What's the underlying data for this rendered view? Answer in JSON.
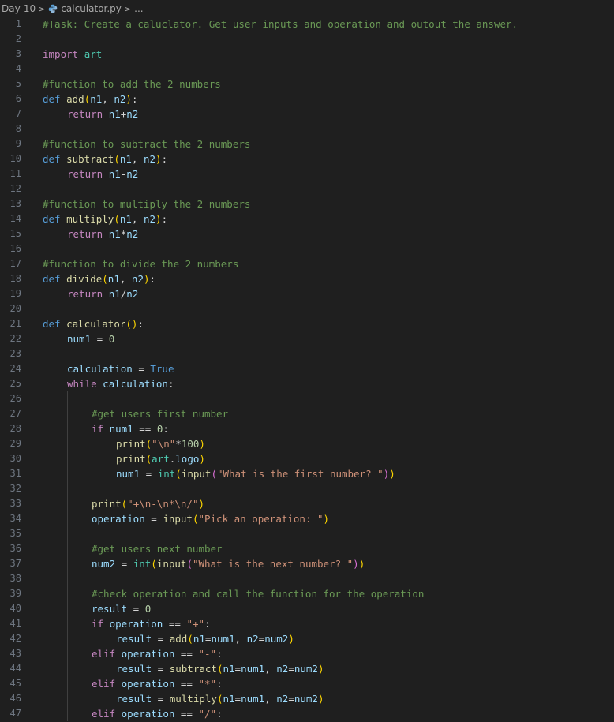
{
  "breadcrumb": {
    "folder": "Day-10",
    "file": "calculator.py",
    "more": "...",
    "separator": ">"
  },
  "colors": {
    "background": "#1f1f1f",
    "line_number": "#6e7681",
    "comment": "#6a9955",
    "keyword": "#569cd6",
    "control": "#c586c0",
    "function": "#dcdcaa",
    "string": "#ce9178",
    "number": "#b5cea8",
    "variable": "#9cdcfe",
    "bracket_1": "#ffd700",
    "bracket_2": "#da70d6",
    "bracket_3": "#179fff"
  },
  "icons": {
    "file_type": "python-file-icon"
  },
  "code": {
    "lines": [
      {
        "n": "1",
        "indent": 0,
        "tokens": [
          [
            "cm",
            "#Task: Create a caluclator. Get user inputs and operation and outout the answer."
          ]
        ]
      },
      {
        "n": "2",
        "indent": 0,
        "tokens": []
      },
      {
        "n": "3",
        "indent": 0,
        "tokens": [
          [
            "ctrl",
            "import"
          ],
          [
            "plain",
            " "
          ],
          [
            "type",
            "art"
          ]
        ]
      },
      {
        "n": "4",
        "indent": 0,
        "tokens": []
      },
      {
        "n": "5",
        "indent": 0,
        "tokens": [
          [
            "cm",
            "#function to add the 2 numbers"
          ]
        ]
      },
      {
        "n": "6",
        "indent": 0,
        "tokens": [
          [
            "kw",
            "def"
          ],
          [
            "plain",
            " "
          ],
          [
            "fn",
            "add"
          ],
          [
            "p1",
            "("
          ],
          [
            "var",
            "n1"
          ],
          [
            "plain",
            ", "
          ],
          [
            "var",
            "n2"
          ],
          [
            "p1",
            ")"
          ],
          [
            "plain",
            ":"
          ]
        ]
      },
      {
        "n": "7",
        "indent": 1,
        "tokens": [
          [
            "ctrl",
            "return"
          ],
          [
            "plain",
            " "
          ],
          [
            "var",
            "n1"
          ],
          [
            "plain",
            "+"
          ],
          [
            "var",
            "n2"
          ]
        ]
      },
      {
        "n": "8",
        "indent": 0,
        "tokens": []
      },
      {
        "n": "9",
        "indent": 0,
        "tokens": [
          [
            "cm",
            "#function to subtract the 2 numbers"
          ]
        ]
      },
      {
        "n": "10",
        "indent": 0,
        "tokens": [
          [
            "kw",
            "def"
          ],
          [
            "plain",
            " "
          ],
          [
            "fn",
            "subtract"
          ],
          [
            "p1",
            "("
          ],
          [
            "var",
            "n1"
          ],
          [
            "plain",
            ", "
          ],
          [
            "var",
            "n2"
          ],
          [
            "p1",
            ")"
          ],
          [
            "plain",
            ":"
          ]
        ]
      },
      {
        "n": "11",
        "indent": 1,
        "tokens": [
          [
            "ctrl",
            "return"
          ],
          [
            "plain",
            " "
          ],
          [
            "var",
            "n1"
          ],
          [
            "plain",
            "-"
          ],
          [
            "var",
            "n2"
          ]
        ]
      },
      {
        "n": "12",
        "indent": 0,
        "tokens": []
      },
      {
        "n": "13",
        "indent": 0,
        "tokens": [
          [
            "cm",
            "#function to multiply the 2 numbers"
          ]
        ]
      },
      {
        "n": "14",
        "indent": 0,
        "tokens": [
          [
            "kw",
            "def"
          ],
          [
            "plain",
            " "
          ],
          [
            "fn",
            "multiply"
          ],
          [
            "p1",
            "("
          ],
          [
            "var",
            "n1"
          ],
          [
            "plain",
            ", "
          ],
          [
            "var",
            "n2"
          ],
          [
            "p1",
            ")"
          ],
          [
            "plain",
            ":"
          ]
        ]
      },
      {
        "n": "15",
        "indent": 1,
        "tokens": [
          [
            "ctrl",
            "return"
          ],
          [
            "plain",
            " "
          ],
          [
            "var",
            "n1"
          ],
          [
            "plain",
            "*"
          ],
          [
            "var",
            "n2"
          ]
        ]
      },
      {
        "n": "16",
        "indent": 0,
        "tokens": []
      },
      {
        "n": "17",
        "indent": 0,
        "tokens": [
          [
            "cm",
            "#function to divide the 2 numbers"
          ]
        ]
      },
      {
        "n": "18",
        "indent": 0,
        "tokens": [
          [
            "kw",
            "def"
          ],
          [
            "plain",
            " "
          ],
          [
            "fn",
            "divide"
          ],
          [
            "p1",
            "("
          ],
          [
            "var",
            "n1"
          ],
          [
            "plain",
            ", "
          ],
          [
            "var",
            "n2"
          ],
          [
            "p1",
            ")"
          ],
          [
            "plain",
            ":"
          ]
        ]
      },
      {
        "n": "19",
        "indent": 1,
        "tokens": [
          [
            "ctrl",
            "return"
          ],
          [
            "plain",
            " "
          ],
          [
            "var",
            "n1"
          ],
          [
            "plain",
            "/"
          ],
          [
            "var",
            "n2"
          ]
        ]
      },
      {
        "n": "20",
        "indent": 0,
        "tokens": []
      },
      {
        "n": "21",
        "indent": 0,
        "tokens": [
          [
            "kw",
            "def"
          ],
          [
            "plain",
            " "
          ],
          [
            "fn",
            "calculator"
          ],
          [
            "p1",
            "()"
          ],
          [
            "plain",
            ":"
          ]
        ]
      },
      {
        "n": "22",
        "indent": 1,
        "tokens": [
          [
            "var",
            "num1"
          ],
          [
            "plain",
            " = "
          ],
          [
            "num",
            "0"
          ]
        ]
      },
      {
        "n": "23",
        "indent": 0,
        "guides": 1,
        "tokens": []
      },
      {
        "n": "24",
        "indent": 1,
        "tokens": [
          [
            "var",
            "calculation"
          ],
          [
            "plain",
            " = "
          ],
          [
            "kw",
            "True"
          ]
        ]
      },
      {
        "n": "25",
        "indent": 1,
        "tokens": [
          [
            "ctrl",
            "while"
          ],
          [
            "plain",
            " "
          ],
          [
            "var",
            "calculation"
          ],
          [
            "plain",
            ":"
          ]
        ]
      },
      {
        "n": "26",
        "indent": 0,
        "guides": 2,
        "tokens": []
      },
      {
        "n": "27",
        "indent": 2,
        "tokens": [
          [
            "cm",
            "#get users first number"
          ]
        ]
      },
      {
        "n": "28",
        "indent": 2,
        "tokens": [
          [
            "ctrl",
            "if"
          ],
          [
            "plain",
            " "
          ],
          [
            "var",
            "num1"
          ],
          [
            "plain",
            " == "
          ],
          [
            "num",
            "0"
          ],
          [
            "plain",
            ":"
          ]
        ]
      },
      {
        "n": "29",
        "indent": 3,
        "tokens": [
          [
            "fn",
            "print"
          ],
          [
            "p1",
            "("
          ],
          [
            "str",
            "\"\\n\""
          ],
          [
            "plain",
            "*"
          ],
          [
            "num",
            "100"
          ],
          [
            "p1",
            ")"
          ]
        ]
      },
      {
        "n": "30",
        "indent": 3,
        "tokens": [
          [
            "fn",
            "print"
          ],
          [
            "p1",
            "("
          ],
          [
            "type",
            "art"
          ],
          [
            "plain",
            "."
          ],
          [
            "var",
            "logo"
          ],
          [
            "p1",
            ")"
          ]
        ]
      },
      {
        "n": "31",
        "indent": 3,
        "tokens": [
          [
            "var",
            "num1"
          ],
          [
            "plain",
            " = "
          ],
          [
            "type",
            "int"
          ],
          [
            "p1",
            "("
          ],
          [
            "fn",
            "input"
          ],
          [
            "p2",
            "("
          ],
          [
            "str",
            "\"What is the first number? \""
          ],
          [
            "p2",
            ")"
          ],
          [
            "p1",
            ")"
          ]
        ]
      },
      {
        "n": "32",
        "indent": 0,
        "guides": 2,
        "tokens": []
      },
      {
        "n": "33",
        "indent": 2,
        "tokens": [
          [
            "fn",
            "print"
          ],
          [
            "p1",
            "("
          ],
          [
            "str",
            "\"+\\n-\\n*\\n/\""
          ],
          [
            "p1",
            ")"
          ]
        ]
      },
      {
        "n": "34",
        "indent": 2,
        "tokens": [
          [
            "var",
            "operation"
          ],
          [
            "plain",
            " = "
          ],
          [
            "fn",
            "input"
          ],
          [
            "p1",
            "("
          ],
          [
            "str",
            "\"Pick an operation: \""
          ],
          [
            "p1",
            ")"
          ]
        ]
      },
      {
        "n": "35",
        "indent": 0,
        "guides": 2,
        "tokens": []
      },
      {
        "n": "36",
        "indent": 2,
        "tokens": [
          [
            "cm",
            "#get users next number"
          ]
        ]
      },
      {
        "n": "37",
        "indent": 2,
        "tokens": [
          [
            "var",
            "num2"
          ],
          [
            "plain",
            " = "
          ],
          [
            "type",
            "int"
          ],
          [
            "p1",
            "("
          ],
          [
            "fn",
            "input"
          ],
          [
            "p2",
            "("
          ],
          [
            "str",
            "\"What is the next number? \""
          ],
          [
            "p2",
            ")"
          ],
          [
            "p1",
            ")"
          ]
        ]
      },
      {
        "n": "38",
        "indent": 0,
        "guides": 2,
        "tokens": []
      },
      {
        "n": "39",
        "indent": 2,
        "tokens": [
          [
            "cm",
            "#check operation and call the function for the operation"
          ]
        ]
      },
      {
        "n": "40",
        "indent": 2,
        "tokens": [
          [
            "var",
            "result"
          ],
          [
            "plain",
            " = "
          ],
          [
            "num",
            "0"
          ]
        ]
      },
      {
        "n": "41",
        "indent": 2,
        "tokens": [
          [
            "ctrl",
            "if"
          ],
          [
            "plain",
            " "
          ],
          [
            "var",
            "operation"
          ],
          [
            "plain",
            " == "
          ],
          [
            "str",
            "\"+\""
          ],
          [
            "plain",
            ":"
          ]
        ]
      },
      {
        "n": "42",
        "indent": 3,
        "tokens": [
          [
            "var",
            "result"
          ],
          [
            "plain",
            " = "
          ],
          [
            "fn",
            "add"
          ],
          [
            "p1",
            "("
          ],
          [
            "var",
            "n1"
          ],
          [
            "plain",
            "="
          ],
          [
            "var",
            "num1"
          ],
          [
            "plain",
            ", "
          ],
          [
            "var",
            "n2"
          ],
          [
            "plain",
            "="
          ],
          [
            "var",
            "num2"
          ],
          [
            "p1",
            ")"
          ]
        ]
      },
      {
        "n": "43",
        "indent": 2,
        "tokens": [
          [
            "ctrl",
            "elif"
          ],
          [
            "plain",
            " "
          ],
          [
            "var",
            "operation"
          ],
          [
            "plain",
            " == "
          ],
          [
            "str",
            "\"-\""
          ],
          [
            "plain",
            ":"
          ]
        ]
      },
      {
        "n": "44",
        "indent": 3,
        "tokens": [
          [
            "var",
            "result"
          ],
          [
            "plain",
            " = "
          ],
          [
            "fn",
            "subtract"
          ],
          [
            "p1",
            "("
          ],
          [
            "var",
            "n1"
          ],
          [
            "plain",
            "="
          ],
          [
            "var",
            "num1"
          ],
          [
            "plain",
            ", "
          ],
          [
            "var",
            "n2"
          ],
          [
            "plain",
            "="
          ],
          [
            "var",
            "num2"
          ],
          [
            "p1",
            ")"
          ]
        ]
      },
      {
        "n": "45",
        "indent": 2,
        "tokens": [
          [
            "ctrl",
            "elif"
          ],
          [
            "plain",
            " "
          ],
          [
            "var",
            "operation"
          ],
          [
            "plain",
            " == "
          ],
          [
            "str",
            "\"*\""
          ],
          [
            "plain",
            ":"
          ]
        ]
      },
      {
        "n": "46",
        "indent": 3,
        "tokens": [
          [
            "var",
            "result"
          ],
          [
            "plain",
            " = "
          ],
          [
            "fn",
            "multiply"
          ],
          [
            "p1",
            "("
          ],
          [
            "var",
            "n1"
          ],
          [
            "plain",
            "="
          ],
          [
            "var",
            "num1"
          ],
          [
            "plain",
            ", "
          ],
          [
            "var",
            "n2"
          ],
          [
            "plain",
            "="
          ],
          [
            "var",
            "num2"
          ],
          [
            "p1",
            ")"
          ]
        ]
      },
      {
        "n": "47",
        "indent": 2,
        "tokens": [
          [
            "ctrl",
            "elif"
          ],
          [
            "plain",
            " "
          ],
          [
            "var",
            "operation"
          ],
          [
            "plain",
            " == "
          ],
          [
            "str",
            "\"/\""
          ],
          [
            "plain",
            ":"
          ]
        ]
      }
    ]
  }
}
